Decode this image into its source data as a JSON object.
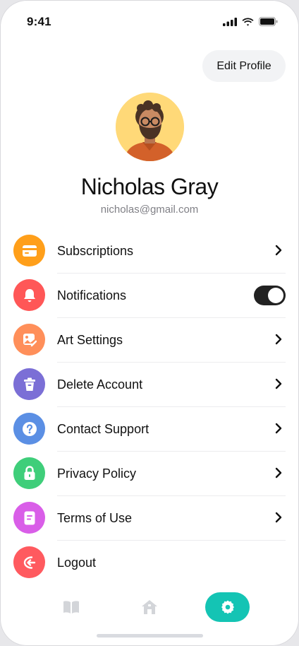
{
  "status_bar": {
    "time": "9:41"
  },
  "header": {
    "edit_profile_label": "Edit Profile"
  },
  "profile": {
    "name": "Nicholas Gray",
    "email": "nicholas@gmail.com"
  },
  "menu": [
    {
      "label": "Subscriptions",
      "icon": "credit-card-icon",
      "color": "#ff9f1a",
      "trailing": "chevron"
    },
    {
      "label": "Notifications",
      "icon": "bell-icon",
      "color": "#ff5757",
      "trailing": "toggle",
      "toggle_on": true
    },
    {
      "label": "Art Settings",
      "icon": "art-image-icon",
      "color": "#ff8f5a",
      "trailing": "chevron"
    },
    {
      "label": "Delete Account",
      "icon": "trash-icon",
      "color": "#7b6fd6",
      "trailing": "chevron"
    },
    {
      "label": "Contact Support",
      "icon": "help-circle-icon",
      "color": "#5b8fe4",
      "trailing": "chevron"
    },
    {
      "label": "Privacy Policy",
      "icon": "lock-icon",
      "color": "#3fce7a",
      "trailing": "chevron"
    },
    {
      "label": "Terms of Use",
      "icon": "document-icon",
      "color": "#d95ee8",
      "trailing": "chevron"
    },
    {
      "label": "Logout",
      "icon": "logout-icon",
      "color": "#ff5a5f",
      "trailing": "none"
    }
  ],
  "tab_bar": {
    "tabs": [
      {
        "name": "library",
        "icon": "book-icon",
        "active": false
      },
      {
        "name": "home",
        "icon": "home-icon",
        "active": false
      },
      {
        "name": "settings",
        "icon": "gear-icon",
        "active": true
      }
    ],
    "active_color": "#14c4b4"
  }
}
